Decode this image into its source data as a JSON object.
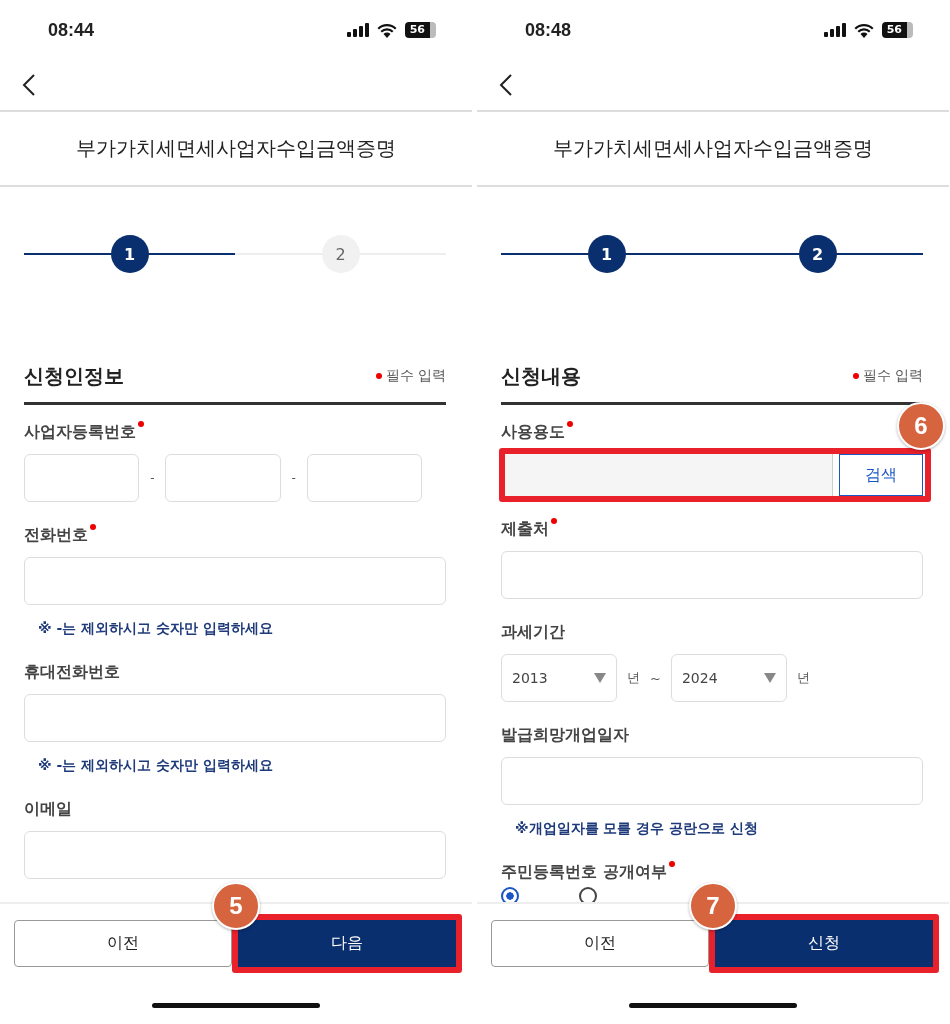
{
  "screens": [
    {
      "time": "08:44",
      "battery": "56",
      "title": "부가가치세면세사업자수입금액증명",
      "steps": [
        {
          "label": "1",
          "done": true
        },
        {
          "label": "2",
          "done": false
        }
      ],
      "section": {
        "title": "신청인정보",
        "required_note": "필수 입력"
      },
      "fields": [
        {
          "kind": "split",
          "label": "사업자등록번호",
          "required": true,
          "separators": [
            "-",
            "-"
          ]
        },
        {
          "kind": "text",
          "label": "전화번호",
          "required": true,
          "note": "※ -는 제외하시고 숫자만 입력하세요"
        },
        {
          "kind": "text",
          "label": "휴대전화번호",
          "required": false,
          "note": "※ -는 제외하시고 숫자만 입력하세요"
        },
        {
          "kind": "text",
          "label": "이메일",
          "required": false
        }
      ],
      "buttons": [
        {
          "label": "이전",
          "primary": false
        },
        {
          "label": "다음",
          "primary": true,
          "callout": "5"
        }
      ]
    },
    {
      "time": "08:48",
      "battery": "56",
      "title": "부가가치세면세사업자수입금액증명",
      "steps": [
        {
          "label": "1",
          "done": true
        },
        {
          "label": "2",
          "done": true
        }
      ],
      "section": {
        "title": "신청내용",
        "required_note": "필수 입력"
      },
      "fields": [
        {
          "kind": "search",
          "label": "사용용도",
          "required": true,
          "button": "검색",
          "callout": "6"
        },
        {
          "kind": "text",
          "label": "제출처",
          "required": true
        },
        {
          "kind": "years",
          "label": "과세기간",
          "required": false,
          "from": {
            "value": "2013",
            "unit": "년"
          },
          "range": "~",
          "to": {
            "value": "2024",
            "unit": "년"
          }
        },
        {
          "kind": "text",
          "label": "발급희망개업일자",
          "required": false,
          "note": "※개업일자를 모를 경우 공란으로 신청"
        },
        {
          "kind": "radio",
          "label": "주민등록번호 공개여부",
          "required": true,
          "options": [
            {
              "selected": true
            },
            {
              "selected": false
            }
          ]
        }
      ],
      "buttons": [
        {
          "label": "이전",
          "primary": false
        },
        {
          "label": "신청",
          "primary": true,
          "callout": "7"
        }
      ]
    }
  ]
}
